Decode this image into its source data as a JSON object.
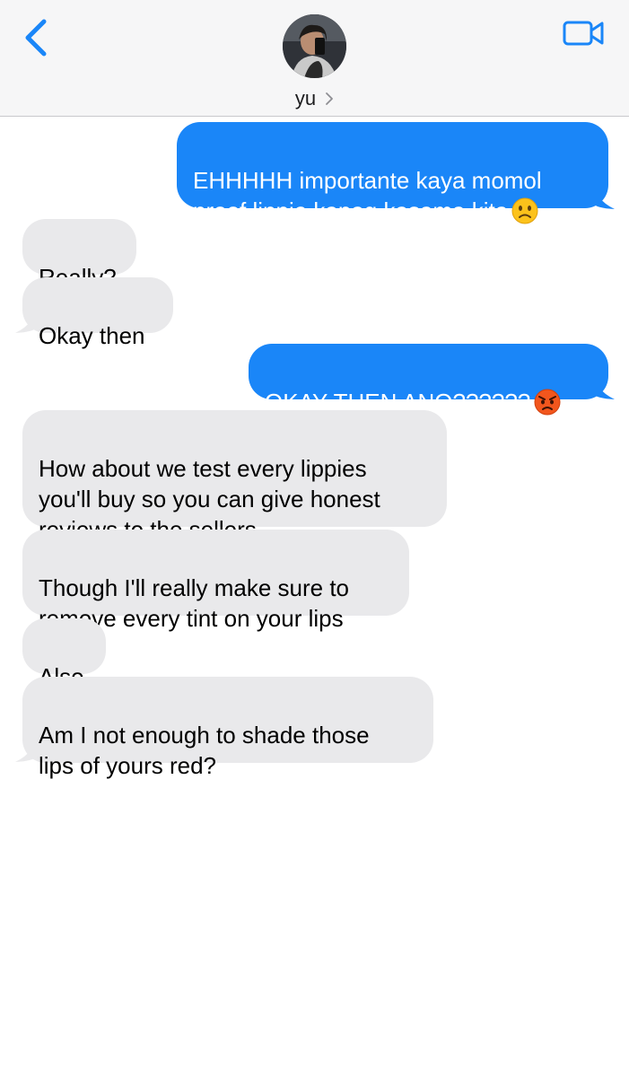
{
  "header": {
    "contact_name": "yu",
    "back_icon": "chevron-left-icon",
    "video_icon": "video-camera-icon",
    "accent_color": "#1a86f8"
  },
  "messages": [
    {
      "side": "sent",
      "text": "EHHHHH importante kaya momol\nproof lippie kapag kasama kita",
      "emoji": "slightly-frowning-face"
    },
    {
      "side": "received",
      "text": "Really?"
    },
    {
      "side": "received",
      "text": "Okay then"
    },
    {
      "side": "sent",
      "text": "OKAY THEN ANO??????",
      "emoji": "angry-face"
    },
    {
      "side": "received",
      "text": "How about we test every lippies\nyou'll buy so you can give honest\nreviews to the sellers"
    },
    {
      "side": "received",
      "text": "Though I'll really make sure to\nremove every tint on your lips"
    },
    {
      "side": "received",
      "text": "Also"
    },
    {
      "side": "received",
      "text": "Am I not enough to shade those\nlips of yours red?"
    }
  ],
  "colors": {
    "sent_bubble": "#1a86f8",
    "received_bubble": "#e9e9eb",
    "header_bg": "#f6f6f7"
  }
}
